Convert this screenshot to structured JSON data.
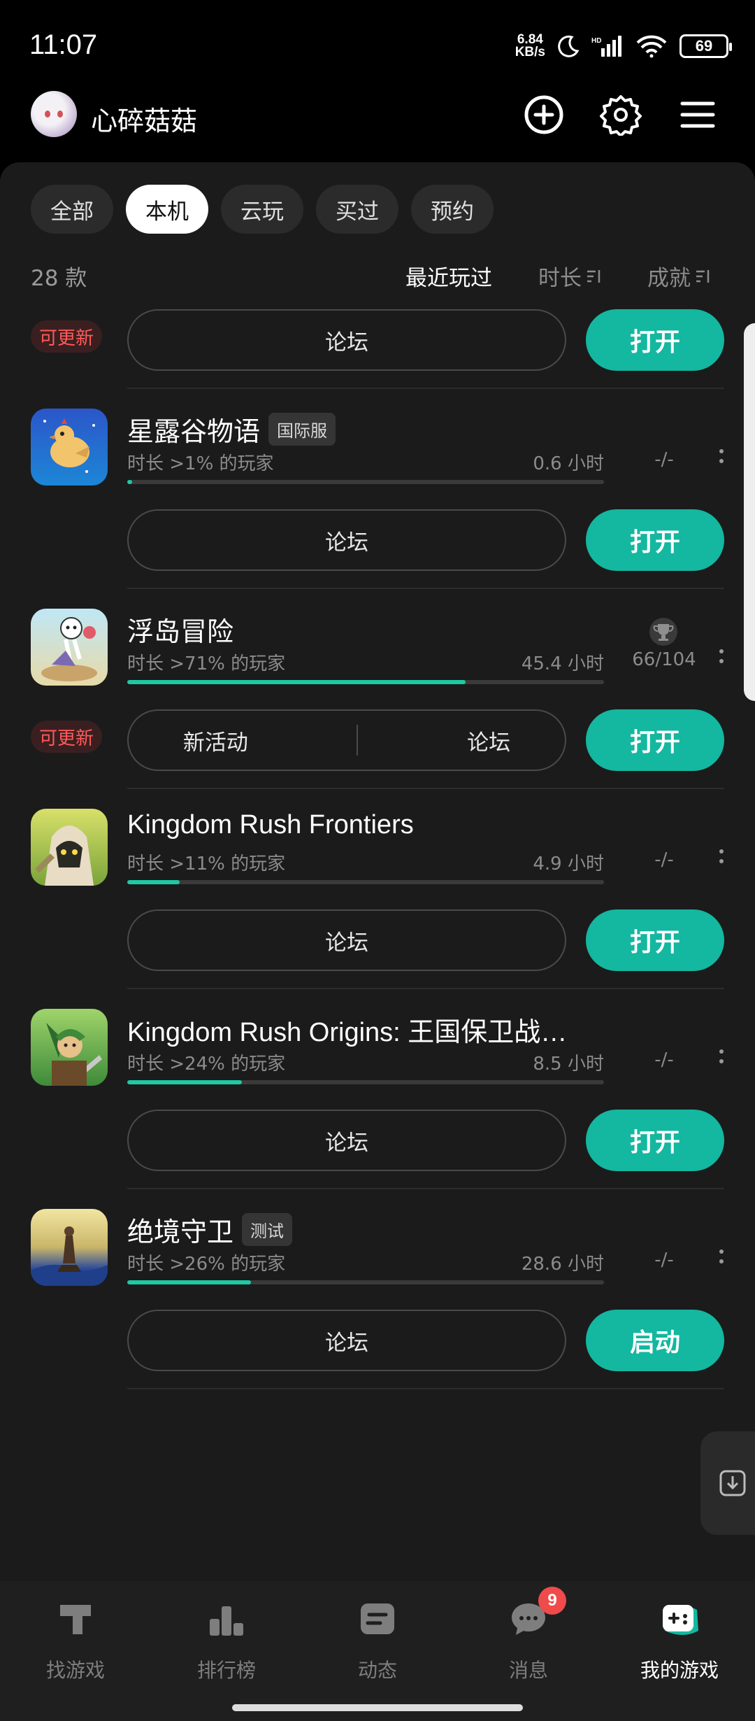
{
  "status_bar": {
    "time": "11:07",
    "net_speed_value": "6.84",
    "net_speed_unit": "KB/s",
    "battery": "69"
  },
  "header": {
    "username": "心碎菇菇"
  },
  "filters": {
    "chips": [
      "全部",
      "本机",
      "云玩",
      "买过",
      "预约"
    ],
    "active": "本机"
  },
  "list_meta": {
    "count": "28 款",
    "sort_recent": "最近玩过",
    "sort_duration": "时长",
    "sort_achieve": "成就"
  },
  "games": [
    {
      "title": "",
      "update_badge": "可更新",
      "forum": "论坛",
      "open": "打开"
    },
    {
      "title": "星露谷物语",
      "tag": "国际服",
      "sub": "时长 >1% 的玩家",
      "hours": "0.6 小时",
      "ach": "-/-",
      "progress": 0.01,
      "forum": "论坛",
      "open": "打开"
    },
    {
      "title": "浮岛冒险",
      "sub": "时长 >71% 的玩家",
      "hours": "45.4 小时",
      "ach": "66/104",
      "progress": 0.71,
      "update_badge": "可更新",
      "forum_left": "新活动",
      "forum": "论坛",
      "open": "打开"
    },
    {
      "title": "Kingdom Rush Frontiers",
      "sub": "时长 >11% 的玩家",
      "hours": "4.9 小时",
      "ach": "-/-",
      "progress": 0.11,
      "forum": "论坛",
      "open": "打开"
    },
    {
      "title": "Kingdom Rush Origins: 王国保卫战…",
      "sub": "时长 >24% 的玩家",
      "hours": "8.5 小时",
      "ach": "-/-",
      "progress": 0.24,
      "forum": "论坛",
      "open": "打开"
    },
    {
      "title": "绝境守卫",
      "tag": "测试",
      "sub": "时长 >26% 的玩家",
      "hours": "28.6 小时",
      "ach": "-/-",
      "progress": 0.26,
      "forum": "论坛",
      "open": "启动"
    }
  ],
  "nav": {
    "items": [
      "找游戏",
      "排行榜",
      "动态",
      "消息",
      "我的游戏"
    ],
    "active": "我的游戏",
    "message_badge": "9"
  },
  "colors": {
    "accent": "#14b7a0",
    "progress": "#1ec9a3",
    "badge_red": "#ff5a5a"
  }
}
